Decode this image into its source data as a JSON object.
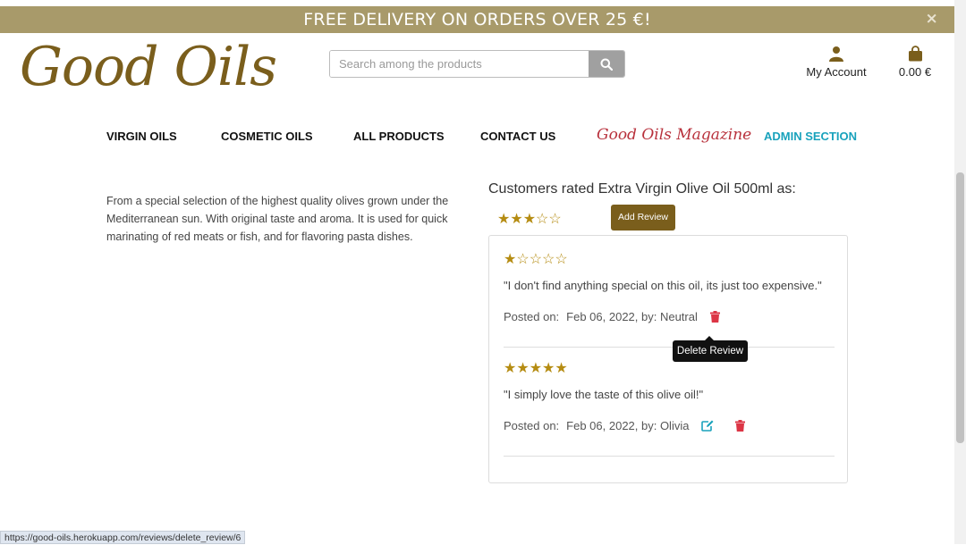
{
  "banner": {
    "text": "FREE DELIVERY ON ORDERS OVER 25 €!",
    "close": "×"
  },
  "brand": {
    "logo_text": "Good Oils"
  },
  "search": {
    "placeholder": "Search among the products"
  },
  "header": {
    "account_label": "My Account",
    "cart_total": "0.00 €"
  },
  "nav": [
    {
      "label": "VIRGIN OILS"
    },
    {
      "label": "COSMETIC OILS"
    },
    {
      "label": "ALL PRODUCTS"
    },
    {
      "label": "CONTACT US"
    },
    {
      "label": "Good Oils Magazine"
    },
    {
      "label": "ADMIN SECTION"
    }
  ],
  "product": {
    "description": "From a special selection of the highest quality olives grown under the Mediterranean sun. With original taste and aroma. It is used for quick marinating of red meats or fish, and for flavoring pasta dishes."
  },
  "ratings": {
    "title": "Customers rated Extra Virgin Olive Oil 500ml as:",
    "average_stars": 3,
    "add_review_label": "Add Review"
  },
  "reviews": [
    {
      "stars": 1,
      "text": "\"I don't find anything special on this oil, its just too expensive.\"",
      "posted_label": "Posted on:",
      "date": "Feb 06, 2022, by: Neutral",
      "can_edit": false
    },
    {
      "stars": 5,
      "text": "\"I simply love the taste of this olive oil!\"",
      "posted_label": "Posted on:",
      "date": "Feb 06, 2022, by: Olivia",
      "can_edit": true
    }
  ],
  "tooltip": {
    "text": "Delete Review"
  },
  "status_url": "https://good-oils.herokuapp.com/reviews/delete_review/6",
  "colors": {
    "banner": "#a89a6a",
    "brand": "#7a5e1c",
    "star": "#b58c12",
    "delete": "#dc3545",
    "edit": "#19a2bc",
    "admin": "#19a2bc",
    "magazine": "#b8313c"
  }
}
